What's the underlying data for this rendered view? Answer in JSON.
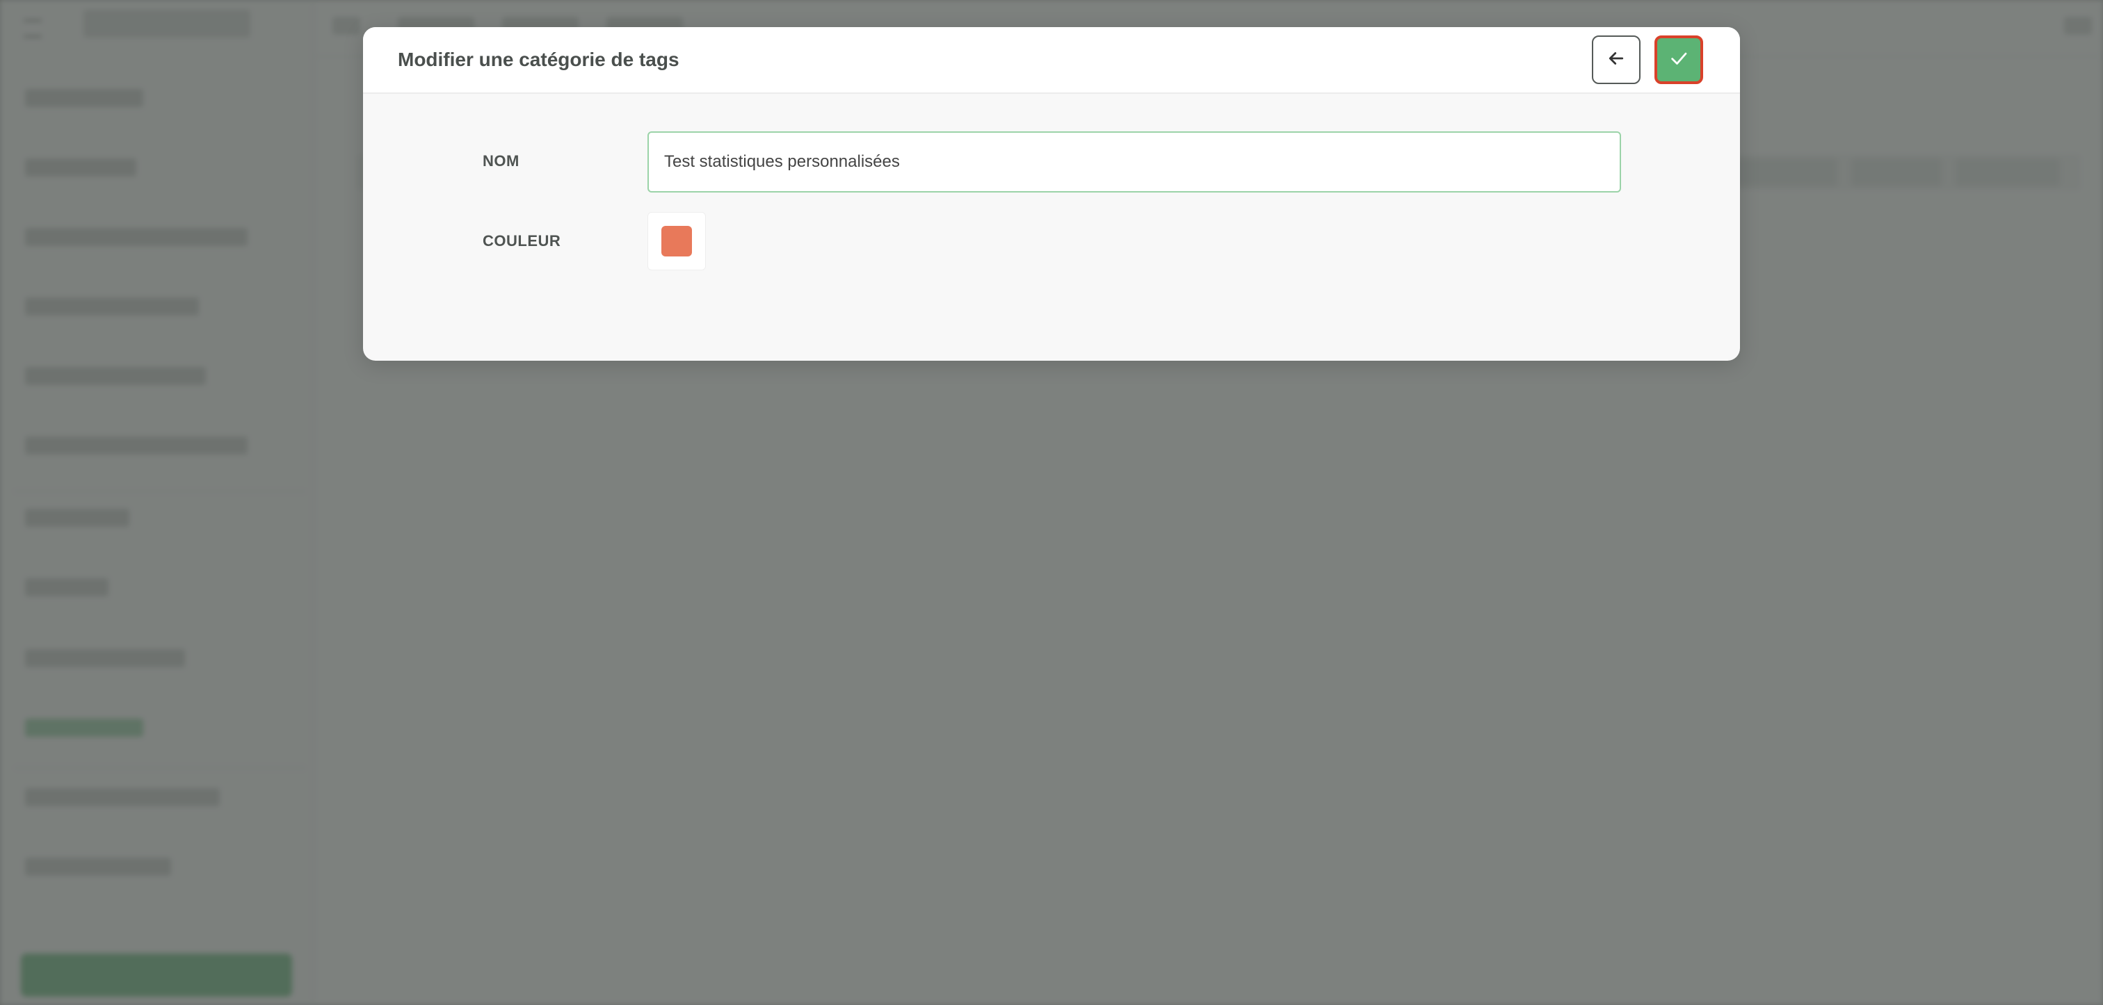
{
  "modal": {
    "title": "Modifier une catégorie de tags",
    "back_icon": "arrow-left-icon",
    "save_icon": "check-icon"
  },
  "form": {
    "name_label": "NOM",
    "name_value": "Test statistiques personnalisées",
    "color_label": "COULEUR",
    "color_value": "#e8795a"
  },
  "colors": {
    "accent_green": "#5cb374",
    "highlight_red": "#d9412a",
    "input_border": "#9bd3a8"
  }
}
